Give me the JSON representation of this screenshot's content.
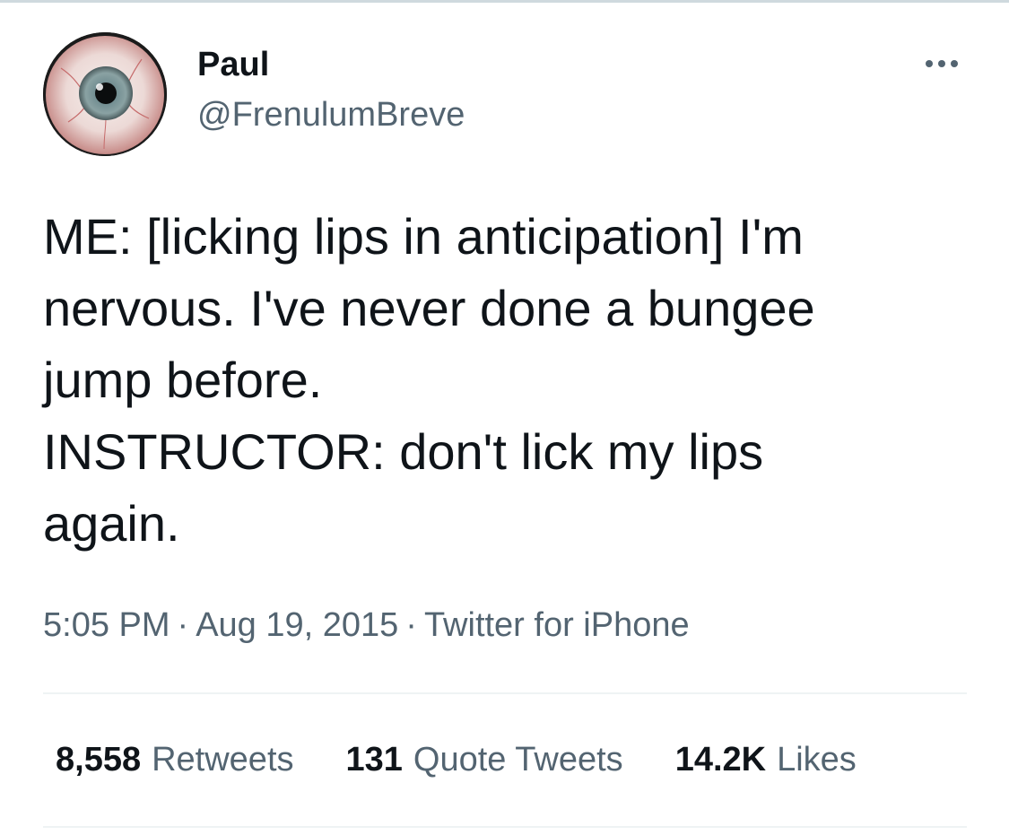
{
  "author": {
    "display_name": "Paul",
    "handle": "@FrenulumBreve",
    "avatar_icon": "eyeball-avatar"
  },
  "menu": {
    "icon": "more-horizontal-icon"
  },
  "tweet": {
    "lines": [
      "ME: [licking lips in anticipation] I'm",
      "nervous. I've never done a bungee",
      "jump before.",
      "INSTRUCTOR: don't lick my lips",
      "again."
    ]
  },
  "meta": {
    "time": "5:05 PM",
    "separator": "·",
    "date": "Aug 19, 2015",
    "source": "Twitter for iPhone"
  },
  "stats": {
    "retweets": {
      "count": "8,558",
      "label": "Retweets"
    },
    "quotes": {
      "count": "131",
      "label": "Quote Tweets"
    },
    "likes": {
      "count": "14.2K",
      "label": "Likes"
    }
  },
  "colors": {
    "text_primary": "#0f1419",
    "text_secondary": "#536471",
    "divider": "#eff3f4"
  }
}
